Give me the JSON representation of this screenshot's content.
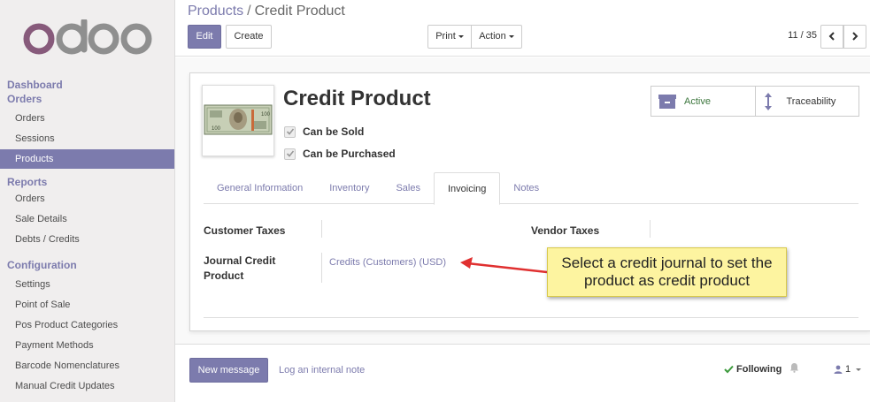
{
  "app": {
    "logo_text": "odoo"
  },
  "sidebar": {
    "dashboard": "Dashboard",
    "groups": [
      {
        "title": "Orders",
        "items": [
          "Orders",
          "Sessions",
          "Products"
        ]
      },
      {
        "title": "Reports",
        "items": [
          "Orders",
          "Sale Details",
          "Debts / Credits"
        ]
      },
      {
        "title": "Configuration",
        "items": [
          "Settings",
          "Point of Sale",
          "Pos Product Categories",
          "Payment Methods",
          "Barcode Nomenclatures",
          "Manual Credit Updates"
        ]
      }
    ],
    "active_item": "Products"
  },
  "breadcrumb": {
    "parent": "Products",
    "separator": "/",
    "current": "Credit Product"
  },
  "toolbar": {
    "edit": "Edit",
    "create": "Create",
    "print": "Print",
    "action": "Action"
  },
  "pager": {
    "value": "11 / 35"
  },
  "product": {
    "name": "Credit Product",
    "can_be_sold_label": "Can be Sold",
    "can_be_sold": true,
    "can_be_purchased_label": "Can be Purchased",
    "can_be_purchased": true
  },
  "stat_buttons": {
    "active": "Active",
    "traceability": "Traceability"
  },
  "tabs": [
    "General Information",
    "Inventory",
    "Sales",
    "Invoicing",
    "Notes"
  ],
  "active_tab": "Invoicing",
  "invoicing": {
    "customer_taxes_label": "Customer Taxes",
    "vendor_taxes_label": "Vendor Taxes",
    "journal_credit_label": "Journal Credit Product",
    "journal_credit_value": "Credits (Customers) (USD)"
  },
  "callout": {
    "text": "Select a credit journal to set the product as credit product"
  },
  "chatter": {
    "new_message": "New message",
    "log_note": "Log an internal note",
    "following": "Following",
    "followers_count": "1"
  },
  "colors": {
    "brand": "#7c7bad",
    "active_green": "#3c763d",
    "callout": "#fdf4a0"
  }
}
